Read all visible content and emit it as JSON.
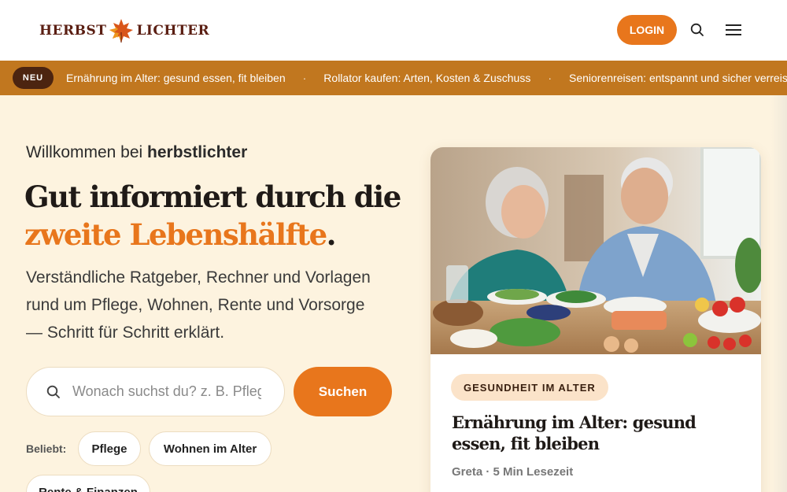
{
  "header": {
    "logo_left": "HERBST",
    "logo_right": "LICHTER",
    "login_label": "LOGIN"
  },
  "ticker": {
    "badge": "NEU",
    "items": [
      "Ernährung im Alter: gesund essen, fit bleiben",
      "Rollator kaufen: Arten, Kosten & Zuschuss",
      "Seniorenreisen: entspannt und sicher verreisen"
    ],
    "separator": "·"
  },
  "hero": {
    "welcome_prefix": "Willkommen bei ",
    "welcome_brand": "herbstlichter",
    "headline_line1": "Gut informiert durch die",
    "headline_accent": "zweite Lebenshälfte",
    "headline_end": ".",
    "lead": "Verständliche Ratgeber, Rechner und Vorlagen rund um Pflege, Wohnen, Rente und Vorsorge — Schritt für Schritt erklärt.",
    "search_placeholder": "Wonach suchst du? z. B. Pflegegrad",
    "search_button": "Suchen",
    "popular_label": "Beliebt:",
    "chips": [
      "Pflege",
      "Wohnen im Alter",
      "Rente & Finanzen"
    ]
  },
  "featured": {
    "tag": "GESUNDHEIT IM ALTER",
    "title": "Ernährung im Alter: gesund essen, fit bleiben",
    "meta": "Greta · 5 Min Lesezeit"
  },
  "colors": {
    "accent": "#e8761c",
    "ticker_bg": "#c1771f",
    "page_bg": "#fdf3df"
  }
}
